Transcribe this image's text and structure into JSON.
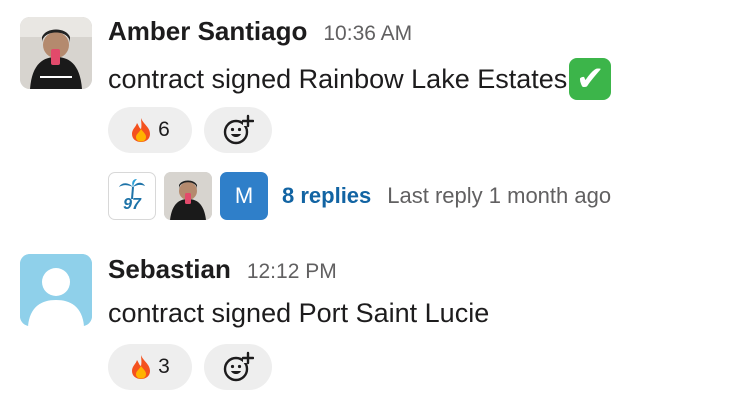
{
  "messages": [
    {
      "sender": "Amber Santiago",
      "time": "10:36 AM",
      "text": "contract signed Rainbow Lake Estates",
      "emoji": "✔",
      "reactions": {
        "fire_count": "6"
      },
      "thread": {
        "avatar_m_letter": "M",
        "avatar_97_number": "97",
        "replies": "8 replies",
        "last_reply": "Last reply 1 month ago"
      }
    },
    {
      "sender": "Sebastian",
      "time": "12:12 PM",
      "text": "contract signed Port Saint Lucie",
      "reactions": {
        "fire_count": "3"
      }
    }
  ],
  "colors": {
    "link": "#1264a3",
    "muted": "#616061",
    "pill": "#eeeeee",
    "check": "#3cb54a"
  },
  "icons": [
    "fire-emoji-icon",
    "add-reaction-icon",
    "check-mark-emoji-icon"
  ]
}
